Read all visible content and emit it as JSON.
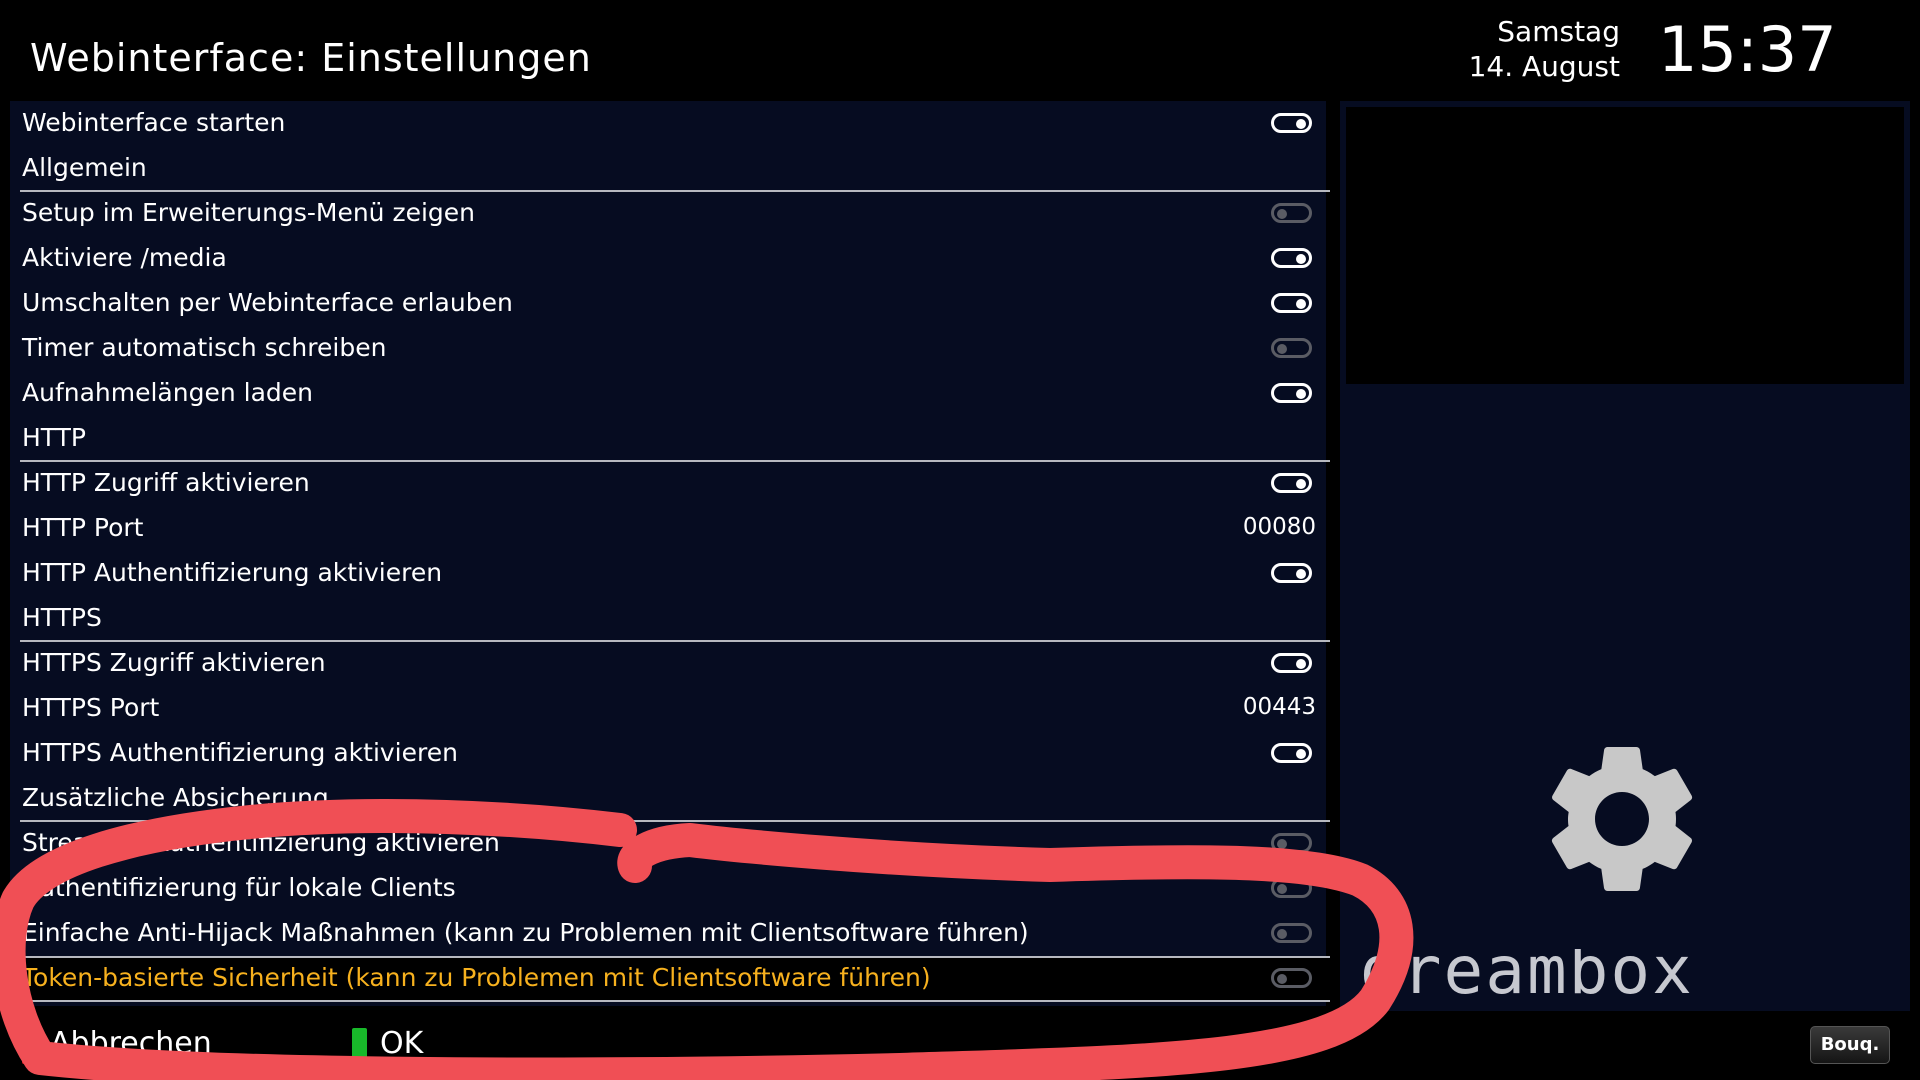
{
  "header": {
    "title": "Webinterface: Einstellungen",
    "day": "Samstag",
    "date": "14. August",
    "time": "15:37"
  },
  "settings": {
    "items": [
      {
        "label": "Webinterface starten",
        "control": "toggle",
        "state": "on"
      },
      {
        "label": "Allgemein",
        "control": "section"
      },
      {
        "label": "Setup im Erweiterungs-Menü zeigen",
        "control": "toggle",
        "state": "off"
      },
      {
        "label": "Aktiviere /media",
        "control": "toggle",
        "state": "on"
      },
      {
        "label": "Umschalten per Webinterface erlauben",
        "control": "toggle",
        "state": "on"
      },
      {
        "label": "Timer automatisch schreiben",
        "control": "toggle",
        "state": "off"
      },
      {
        "label": "Aufnahmelängen laden",
        "control": "toggle",
        "state": "on"
      },
      {
        "label": "HTTP",
        "control": "section"
      },
      {
        "label": "HTTP Zugriff aktivieren",
        "control": "toggle",
        "state": "on"
      },
      {
        "label": "HTTP Port",
        "control": "value",
        "value": "00080"
      },
      {
        "label": "HTTP Authentifizierung aktivieren",
        "control": "toggle",
        "state": "on"
      },
      {
        "label": "HTTPS",
        "control": "section"
      },
      {
        "label": "HTTPS Zugriff aktivieren",
        "control": "toggle",
        "state": "on"
      },
      {
        "label": "HTTPS Port",
        "control": "value",
        "value": "00443"
      },
      {
        "label": "HTTPS Authentifizierung aktivieren",
        "control": "toggle",
        "state": "on"
      },
      {
        "label": "Zusätzliche Absicherung",
        "control": "section"
      },
      {
        "label": "Streamen Authentifizierung aktivieren",
        "control": "toggle",
        "state": "off"
      },
      {
        "label": "Authentifizierung für lokale Clients",
        "control": "toggle",
        "state": "off"
      },
      {
        "label": "Einfache Anti-Hijack Maßnahmen (kann zu Problemen mit Clientsoftware führen)",
        "control": "toggle",
        "state": "off"
      },
      {
        "label": "Token-basierte Sicherheit (kann zu Problemen mit Clientsoftware führen)",
        "control": "toggle",
        "state": "off",
        "selected": true
      }
    ]
  },
  "side_panel": {
    "logo_text": "dreambox",
    "icon": "gear-icon"
  },
  "buttons": {
    "red_label": "Abbrechen",
    "green_label": "OK",
    "bouq_label": "Bouq."
  },
  "colors": {
    "panel_bg": "#060c21",
    "selected_text": "#f7b11e",
    "annotation": "#f04f55",
    "red_key": "#e0161b",
    "green_key": "#18b92a"
  }
}
